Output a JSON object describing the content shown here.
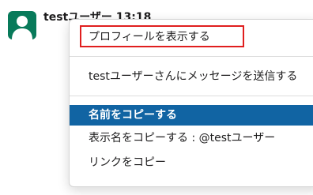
{
  "message": {
    "username": "testユーザー 13:18"
  },
  "menu": {
    "items": [
      {
        "label": "プロフィールを表示する"
      },
      {
        "label": "testユーザーさんにメッセージを送信する"
      },
      {
        "label": "名前をコピーする"
      },
      {
        "label": "表示名をコピーする : @testユーザー"
      },
      {
        "label": "リンクをコピー"
      }
    ],
    "active_index": 2
  },
  "colors": {
    "avatar_bg": "#087a5a",
    "active_bg": "#1164a3",
    "highlight_border": "#e01e1e"
  }
}
